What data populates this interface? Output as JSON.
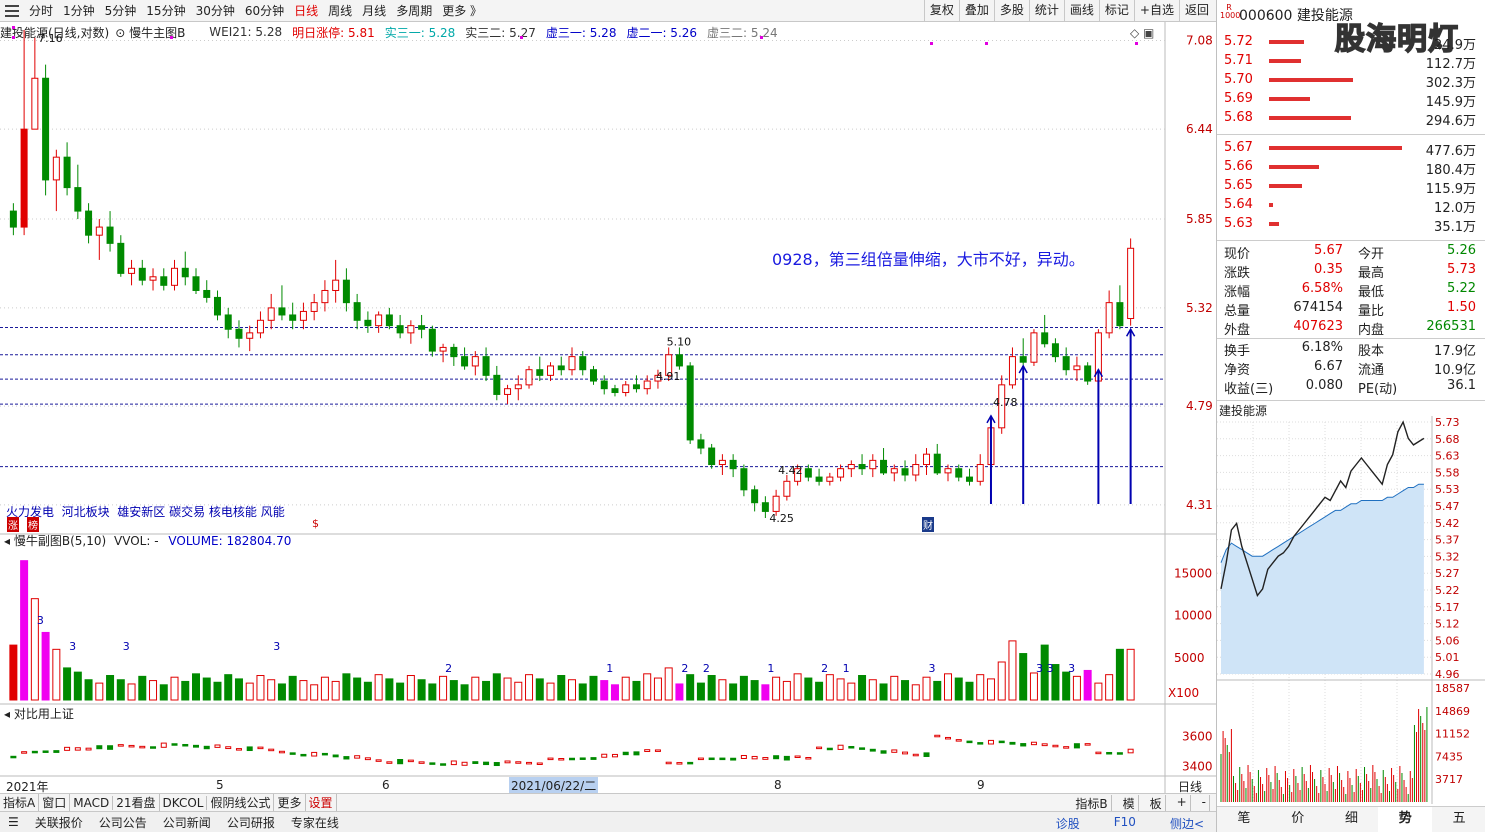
{
  "toolbar": {
    "tabs": [
      "分时",
      "1分钟",
      "5分钟",
      "15分钟",
      "30分钟",
      "60分钟",
      "日线",
      "周线",
      "月线",
      "多周期",
      "更多 》"
    ],
    "active_tab": "日线",
    "right_buttons": [
      "复权",
      "叠加",
      "多股",
      "统计",
      "画线",
      "标记",
      "+自选",
      "返回"
    ]
  },
  "legend": {
    "title": "建投能源(日线,对数)",
    "indicator": "慢牛主图B",
    "wei": "WEI21: 5.28",
    "limit_up": "明日涨停: 5.81",
    "shi3_1": "实三一: 5.28",
    "shi3_2": "实三二: 5.27",
    "xu3_1": "虚三一: 5.28",
    "xu2_1": "虚二一: 5.26",
    "xu3_2": "虚三二: 5.24"
  },
  "price_axis": [
    "7.08",
    "6.44",
    "5.85",
    "5.32",
    "4.79",
    "4.31"
  ],
  "annotation": "0928，第三组倍量伸缩，大市不好，异动。",
  "labels": {
    "high": "7.16",
    "low": "4.25",
    "p510": "5.10",
    "p491": "4.91",
    "p478": "4.78",
    "p442": "4.42"
  },
  "concepts": "火力发电  河北板块  雄安新区 碳交易 核电核能 风能",
  "concept_badges": {
    "zhang": "涨",
    "bang": "榜",
    "s": "$",
    "cai": "财"
  },
  "vol_pane": {
    "title": "慢牛副图B(5,10)",
    "vvol": "VVOL: -",
    "volume": "VOLUME: 182804.70",
    "axis": [
      "15000",
      "10000",
      "5000"
    ],
    "scale": "X100",
    "marks": [
      "3",
      "3",
      "3",
      "3",
      "2",
      "1",
      "2",
      "2",
      "1",
      "2",
      "1",
      "3",
      "3",
      "3",
      "3"
    ]
  },
  "cmp_pane": {
    "title": "对比用上证",
    "axis": [
      "3600",
      "3400"
    ]
  },
  "date_axis": {
    "year": "2021年",
    "months": [
      "5",
      "6",
      "8",
      "9"
    ],
    "cursor": "2021/06/22/二",
    "period": "日线"
  },
  "tabbar": [
    "指标A",
    "窗口",
    "MACD",
    "21看盘",
    "DKCOL",
    "假阴线公式",
    "更多",
    "设置"
  ],
  "tabbar_right": [
    "指标B",
    "模",
    "板",
    "+",
    "-"
  ],
  "bottombar": [
    "关联报价",
    "公司公告",
    "公司新闻",
    "公司研报",
    "专家在线"
  ],
  "bottombar_right": [
    "诊股",
    "F10",
    "侧边<"
  ],
  "stock": {
    "code": "000600",
    "name": "建投能源",
    "logo": "R\n1000",
    "watermark": "股海明灯"
  },
  "orderbook_sell": [
    {
      "price": "5.72",
      "vol": "24.9万",
      "w": 35
    },
    {
      "price": "5.71",
      "vol": "112.7万",
      "w": 32
    },
    {
      "price": "5.70",
      "vol": "302.3万",
      "w": 84
    },
    {
      "price": "5.69",
      "vol": "145.9万",
      "w": 41
    },
    {
      "price": "5.68",
      "vol": "294.6万",
      "w": 82
    }
  ],
  "orderbook_buy": [
    {
      "price": "5.67",
      "vol": "477.6万",
      "w": 133
    },
    {
      "price": "5.66",
      "vol": "180.4万",
      "w": 50
    },
    {
      "price": "5.65",
      "vol": "115.9万",
      "w": 33
    },
    {
      "price": "5.64",
      "vol": "12.0万",
      "w": 4
    },
    {
      "price": "5.63",
      "vol": "35.1万",
      "w": 10
    }
  ],
  "quote": [
    {
      "l1": "现价",
      "v1": "5.67",
      "c1": "red",
      "l2": "今开",
      "v2": "5.26",
      "c2": "green"
    },
    {
      "l1": "涨跌",
      "v1": "0.35",
      "c1": "red",
      "l2": "最高",
      "v2": "5.73",
      "c2": "red"
    },
    {
      "l1": "涨幅",
      "v1": "6.58%",
      "c1": "red",
      "l2": "最低",
      "v2": "5.22",
      "c2": "green"
    },
    {
      "l1": "总量",
      "v1": "674154",
      "c1": "",
      "l2": "量比",
      "v2": "1.50",
      "c2": "red"
    },
    {
      "l1": "外盘",
      "v1": "407623",
      "c1": "red",
      "l2": "内盘",
      "v2": "266531",
      "c2": "green"
    }
  ],
  "quote2": [
    {
      "l1": "换手",
      "v1": "6.18%",
      "l2": "股本",
      "v2": "17.9亿"
    },
    {
      "l1": "净资",
      "v1": "6.67",
      "l2": "流通",
      "v2": "10.9亿"
    },
    {
      "l1": "收益(三)",
      "v1": "0.080",
      "l2": "PE(动)",
      "v2": "36.1"
    }
  ],
  "mini": {
    "title": "建投能源",
    "price_axis": [
      "5.73",
      "5.68",
      "5.63",
      "5.58",
      "5.53",
      "5.47",
      "5.42",
      "5.37",
      "5.32",
      "5.27",
      "5.22",
      "5.17",
      "5.12",
      "5.06",
      "5.01",
      "4.96"
    ],
    "vol_axis": [
      "18587",
      "14869",
      "11152",
      "7435",
      "3717"
    ]
  },
  "mini_tabs": [
    "笔",
    "价",
    "细",
    "势",
    "五"
  ],
  "chart_data": {
    "type": "candlestick",
    "ylim": [
      4.25,
      7.16
    ],
    "ref_lines": [
      5.21,
      5.06,
      4.93,
      4.8,
      4.49
    ],
    "candles": [
      [
        5.9,
        5.95,
        5.75,
        5.8
      ],
      [
        5.8,
        7.16,
        5.75,
        6.44
      ],
      [
        6.44,
        7.1,
        6.6,
        6.8
      ],
      [
        6.8,
        6.9,
        6.0,
        6.1
      ],
      [
        6.1,
        6.3,
        5.9,
        6.25
      ],
      [
        6.25,
        6.35,
        6.0,
        6.05
      ],
      [
        6.05,
        6.2,
        5.85,
        5.9
      ],
      [
        5.9,
        5.95,
        5.7,
        5.75
      ],
      [
        5.75,
        5.85,
        5.6,
        5.8
      ],
      [
        5.8,
        5.9,
        5.65,
        5.7
      ],
      [
        5.7,
        5.75,
        5.5,
        5.52
      ],
      [
        5.52,
        5.6,
        5.45,
        5.55
      ],
      [
        5.55,
        5.6,
        5.45,
        5.48
      ],
      [
        5.48,
        5.55,
        5.42,
        5.5
      ],
      [
        5.5,
        5.55,
        5.42,
        5.45
      ],
      [
        5.45,
        5.6,
        5.42,
        5.55
      ],
      [
        5.55,
        5.65,
        5.45,
        5.5
      ],
      [
        5.5,
        5.55,
        5.4,
        5.42
      ],
      [
        5.42,
        5.48,
        5.35,
        5.38
      ],
      [
        5.38,
        5.42,
        5.25,
        5.28
      ],
      [
        5.28,
        5.32,
        5.15,
        5.2
      ],
      [
        5.2,
        5.25,
        5.1,
        5.15
      ],
      [
        5.15,
        5.22,
        5.08,
        5.18
      ],
      [
        5.18,
        5.3,
        5.15,
        5.25
      ],
      [
        5.25,
        5.4,
        5.2,
        5.32
      ],
      [
        5.32,
        5.45,
        5.25,
        5.28
      ],
      [
        5.28,
        5.35,
        5.2,
        5.25
      ],
      [
        5.25,
        5.35,
        5.2,
        5.3
      ],
      [
        5.3,
        5.4,
        5.25,
        5.35
      ],
      [
        5.35,
        5.48,
        5.3,
        5.42
      ],
      [
        5.42,
        5.6,
        5.35,
        5.48
      ],
      [
        5.48,
        5.55,
        5.3,
        5.35
      ],
      [
        5.35,
        5.4,
        5.2,
        5.25
      ],
      [
        5.25,
        5.3,
        5.18,
        5.22
      ],
      [
        5.22,
        5.3,
        5.18,
        5.28
      ],
      [
        5.28,
        5.32,
        5.2,
        5.22
      ],
      [
        5.22,
        5.28,
        5.15,
        5.18
      ],
      [
        5.18,
        5.25,
        5.12,
        5.22
      ],
      [
        5.22,
        5.28,
        5.15,
        5.2
      ],
      [
        5.2,
        5.22,
        5.05,
        5.08
      ],
      [
        5.08,
        5.12,
        5.02,
        5.1
      ],
      [
        5.1,
        5.12,
        5.0,
        5.05
      ],
      [
        5.05,
        5.1,
        4.98,
        5.0
      ],
      [
        5.0,
        5.08,
        4.95,
        5.05
      ],
      [
        5.05,
        5.1,
        4.92,
        4.95
      ],
      [
        4.95,
        5.0,
        4.82,
        4.85
      ],
      [
        4.85,
        4.9,
        4.8,
        4.88
      ],
      [
        4.88,
        4.95,
        4.82,
        4.9
      ],
      [
        4.9,
        5.0,
        4.88,
        4.98
      ],
      [
        4.98,
        5.05,
        4.92,
        4.95
      ],
      [
        4.95,
        5.02,
        4.92,
        5.0
      ],
      [
        5.0,
        5.05,
        4.95,
        4.98
      ],
      [
        4.98,
        5.1,
        4.95,
        5.05
      ],
      [
        5.05,
        5.08,
        4.95,
        4.98
      ],
      [
        4.98,
        5.0,
        4.9,
        4.92
      ],
      [
        4.92,
        4.95,
        4.85,
        4.88
      ],
      [
        4.88,
        4.9,
        4.84,
        4.86
      ],
      [
        4.86,
        4.92,
        4.84,
        4.9
      ],
      [
        4.9,
        4.95,
        4.86,
        4.88
      ],
      [
        4.88,
        4.95,
        4.85,
        4.92
      ],
      [
        4.92,
        4.98,
        4.88,
        4.95
      ],
      [
        4.95,
        5.1,
        4.92,
        5.06
      ],
      [
        5.06,
        5.1,
        4.98,
        5.0
      ],
      [
        5.0,
        5.02,
        4.6,
        4.62
      ],
      [
        4.62,
        4.65,
        4.55,
        4.58
      ],
      [
        4.58,
        4.6,
        4.48,
        4.5
      ],
      [
        4.5,
        4.55,
        4.45,
        4.52
      ],
      [
        4.52,
        4.55,
        4.44,
        4.48
      ],
      [
        4.48,
        4.5,
        4.35,
        4.38
      ],
      [
        4.38,
        4.4,
        4.28,
        4.32
      ],
      [
        4.32,
        4.35,
        4.25,
        4.28
      ],
      [
        4.28,
        4.38,
        4.26,
        4.35
      ],
      [
        4.35,
        4.45,
        4.33,
        4.42
      ],
      [
        4.42,
        4.5,
        4.4,
        4.48
      ],
      [
        4.48,
        4.5,
        4.42,
        4.44
      ],
      [
        4.44,
        4.48,
        4.4,
        4.42
      ],
      [
        4.42,
        4.46,
        4.4,
        4.44
      ],
      [
        4.44,
        4.5,
        4.42,
        4.48
      ],
      [
        4.48,
        4.52,
        4.44,
        4.5
      ],
      [
        4.5,
        4.55,
        4.45,
        4.48
      ],
      [
        4.48,
        4.55,
        4.44,
        4.52
      ],
      [
        4.52,
        4.58,
        4.45,
        4.46
      ],
      [
        4.46,
        4.5,
        4.42,
        4.48
      ],
      [
        4.48,
        4.52,
        4.42,
        4.45
      ],
      [
        4.45,
        4.55,
        4.42,
        4.5
      ],
      [
        4.5,
        4.58,
        4.45,
        4.55
      ],
      [
        4.55,
        4.6,
        4.45,
        4.46
      ],
      [
        4.46,
        4.5,
        4.42,
        4.48
      ],
      [
        4.48,
        4.5,
        4.42,
        4.44
      ],
      [
        4.44,
        4.48,
        4.4,
        4.42
      ],
      [
        4.42,
        4.55,
        4.4,
        4.5
      ],
      [
        4.5,
        4.7,
        4.48,
        4.68
      ],
      [
        4.68,
        4.95,
        4.65,
        4.9
      ],
      [
        4.9,
        5.1,
        4.88,
        5.05
      ],
      [
        5.05,
        5.15,
        5.0,
        5.02
      ],
      [
        5.02,
        5.2,
        5.0,
        5.18
      ],
      [
        5.18,
        5.28,
        5.1,
        5.12
      ],
      [
        5.12,
        5.15,
        5.02,
        5.05
      ],
      [
        5.05,
        5.1,
        4.95,
        4.98
      ],
      [
        4.98,
        5.05,
        4.92,
        5.0
      ],
      [
        5.0,
        5.02,
        4.9,
        4.92
      ],
      [
        4.92,
        5.2,
        4.9,
        5.18
      ],
      [
        5.18,
        5.42,
        5.15,
        5.35
      ],
      [
        5.35,
        5.45,
        5.2,
        5.22
      ],
      [
        5.26,
        5.73,
        5.22,
        5.67
      ]
    ]
  }
}
